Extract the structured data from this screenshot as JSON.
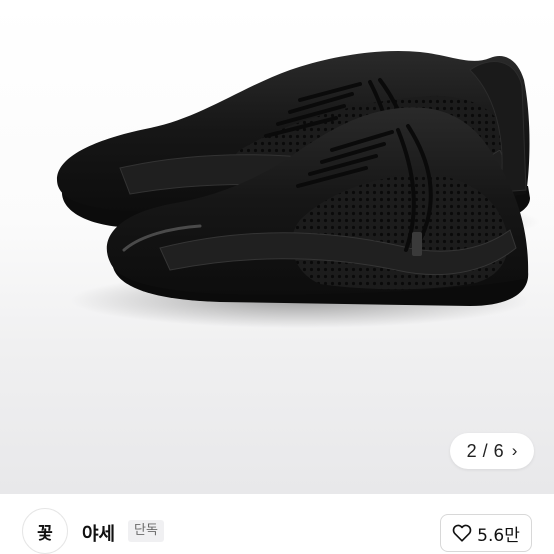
{
  "product": {
    "image_icon": "black-mesh-leather-sneakers-photo",
    "pager": {
      "current": "2",
      "separator": "/",
      "total": "6",
      "next_icon": "chevron-right-icon"
    }
  },
  "seller": {
    "avatar_text": "꽃",
    "name": "야세",
    "badge": "단독"
  },
  "like": {
    "icon": "heart-outline-icon",
    "count": "5.6만"
  },
  "colors": {
    "shoe": "#151515",
    "background_top": "#ffffff",
    "background_bottom": "#e8e8ea",
    "badge_bg": "#f0f0f2"
  }
}
